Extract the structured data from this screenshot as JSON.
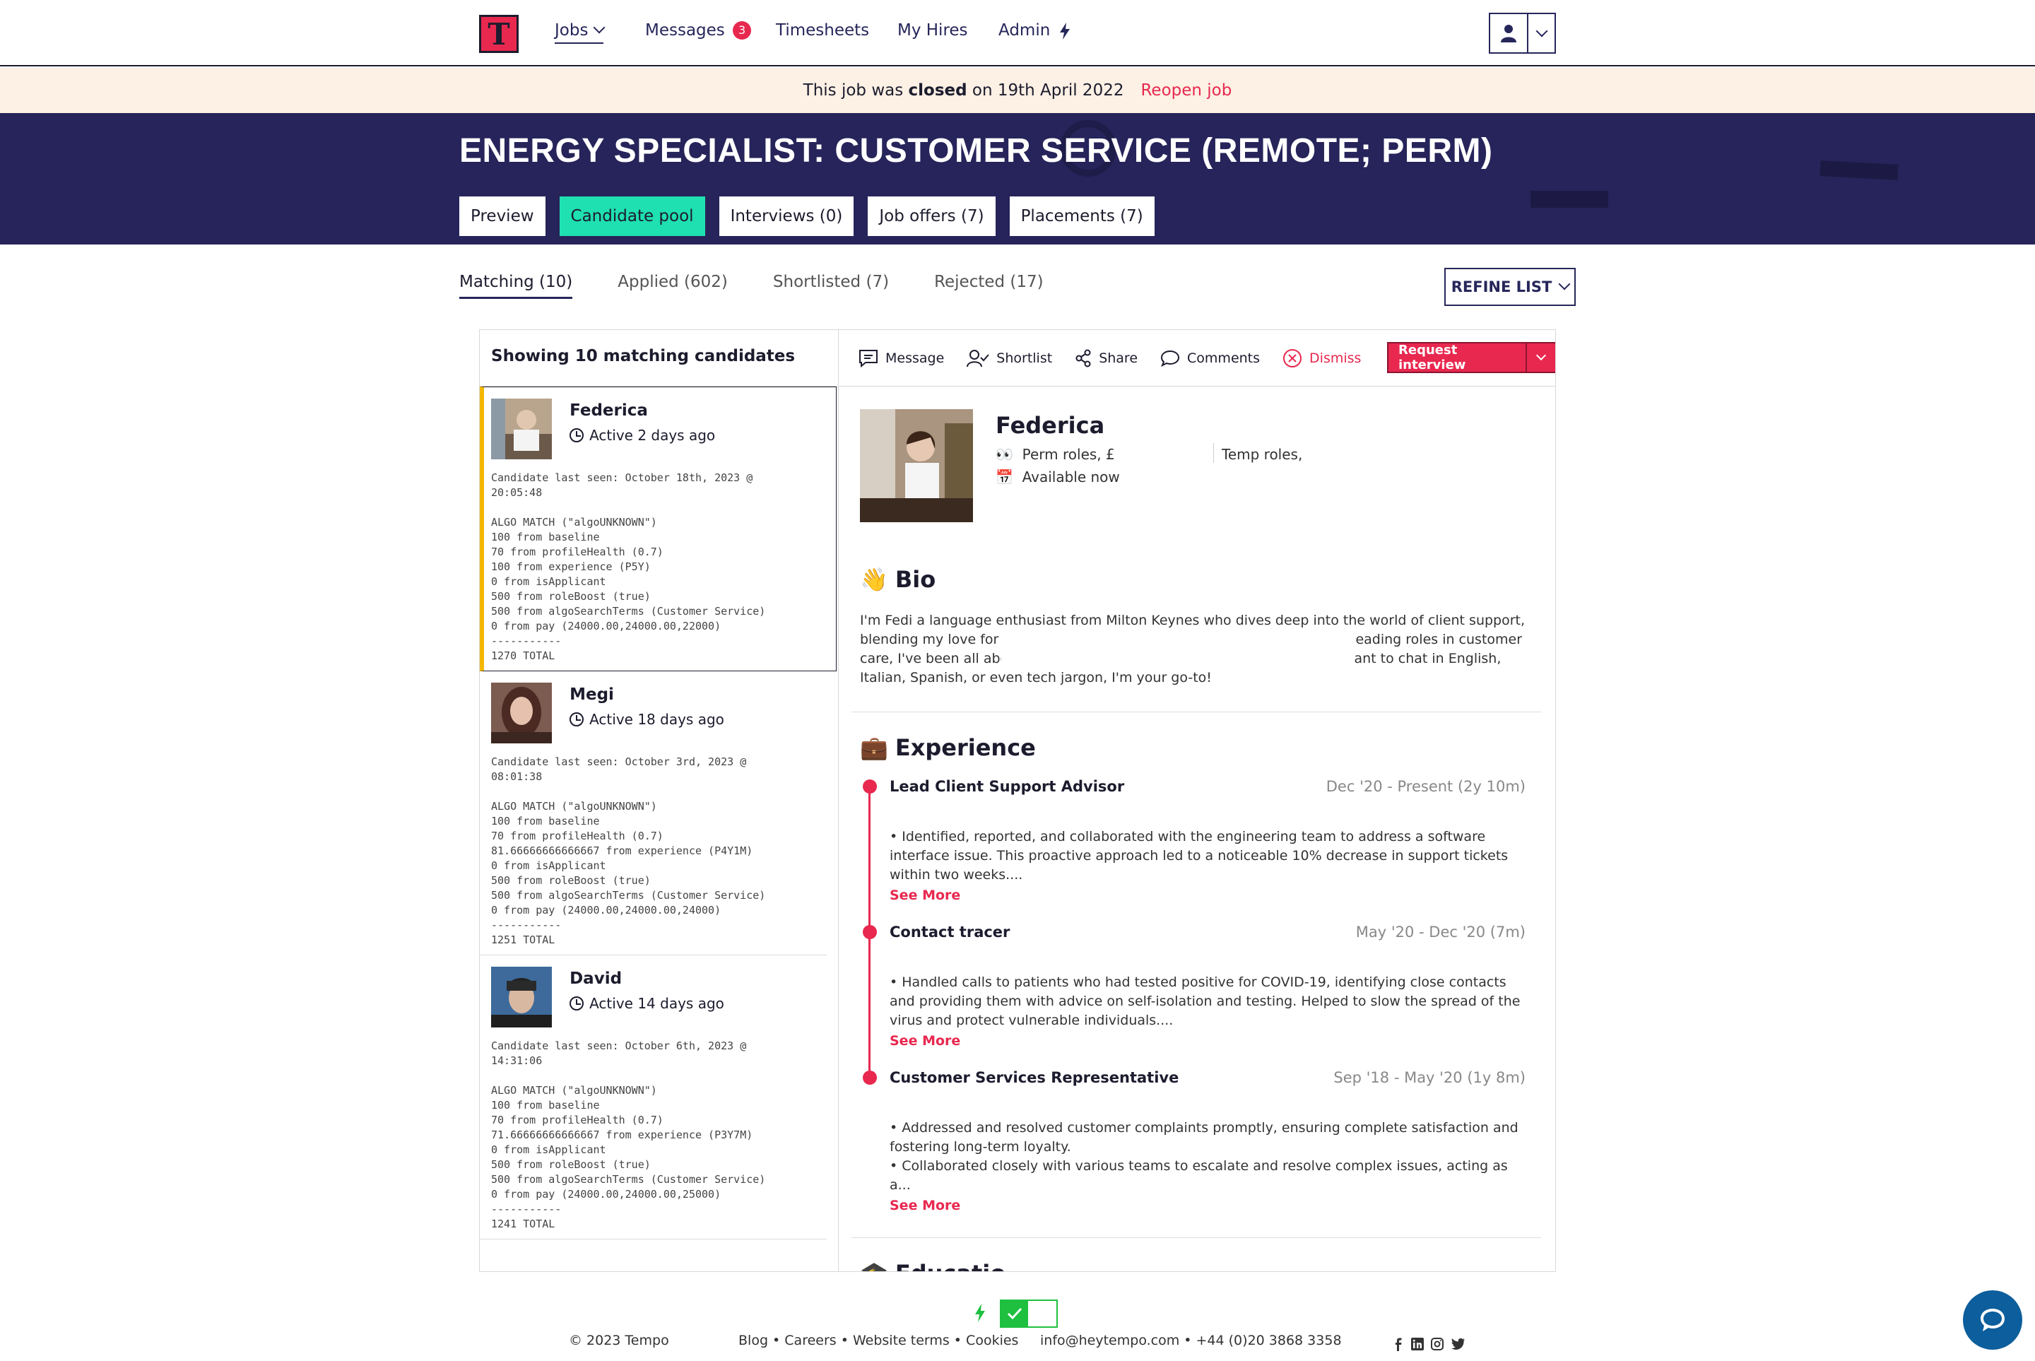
{
  "nav": {
    "logo_letter": "T",
    "items": [
      {
        "label": "Jobs"
      },
      {
        "label": "Messages",
        "badge": "3"
      },
      {
        "label": "Timesheets"
      },
      {
        "label": "My Hires"
      },
      {
        "label": "Admin"
      }
    ]
  },
  "banner": {
    "prefix": "This job was",
    "closed_word": "closed",
    "suffix": "on 19th April 2022",
    "reopen_label": "Reopen job"
  },
  "job": {
    "title": "ENERGY SPECIALIST: CUSTOMER SERVICE (REMOTE; PERM)",
    "tabs": [
      {
        "label": "Preview"
      },
      {
        "label": "Candidate pool"
      },
      {
        "label": "Interviews (0)"
      },
      {
        "label": "Job offers (7)"
      },
      {
        "label": "Placements (7)"
      }
    ]
  },
  "subtabs": [
    {
      "label": "Matching (10)"
    },
    {
      "label": "Applied (602)"
    },
    {
      "label": "Shortlisted (7)"
    },
    {
      "label": "Rejected (17)"
    }
  ],
  "refine_label": "REFINE LIST",
  "list": {
    "heading": "Showing 10 matching candidates",
    "candidates": [
      {
        "name": "Federica",
        "active": "Active 2 days ago",
        "last_seen_1": "Candidate last seen: October 18th, 2023 @",
        "last_seen_2": "20:05:48",
        "algo": [
          "ALGO MATCH (\"algoUNKNOWN\")",
          "100 from baseline",
          "70 from profileHealth (0.7)",
          "100 from experience (P5Y)",
          "0 from isApplicant",
          "500 from roleBoost (true)",
          "500 from algoSearchTerms (Customer Service)",
          "0 from pay (24000.00,24000.00,22000)",
          "-----------",
          "1270 TOTAL"
        ]
      },
      {
        "name": "Megi",
        "active": "Active 18 days ago",
        "last_seen_1": "Candidate last seen: October 3rd, 2023 @",
        "last_seen_2": "08:01:38",
        "algo": [
          "ALGO MATCH (\"algoUNKNOWN\")",
          "100 from baseline",
          "70 from profileHealth (0.7)",
          "81.66666666666667 from experience (P4Y1M)",
          "0 from isApplicant",
          "500 from roleBoost (true)",
          "500 from algoSearchTerms (Customer Service)",
          "0 from pay (24000.00,24000.00,24000)",
          "-----------",
          "1251 TOTAL"
        ]
      },
      {
        "name": "David",
        "active": "Active 14 days ago",
        "last_seen_1": "Candidate last seen: October 6th, 2023 @",
        "last_seen_2": "14:31:06",
        "algo": [
          "ALGO MATCH (\"algoUNKNOWN\")",
          "100 from baseline",
          "70 from profileHealth (0.7)",
          "71.66666666666667 from experience (P3Y7M)",
          "0 from isApplicant",
          "500 from roleBoost (true)",
          "500 from algoSearchTerms (Customer Service)",
          "0 from pay (24000.00,24000.00,25000)",
          "-----------",
          "1241 TOTAL"
        ]
      }
    ]
  },
  "toolbar": {
    "message": "Message",
    "shortlist": "Shortlist",
    "share": "Share",
    "comments": "Comments",
    "dismiss": "Dismiss",
    "request": "Request interview"
  },
  "profile": {
    "name": "Federica",
    "perm": "Perm roles, £",
    "temp": "Temp roles,",
    "availability": "Available now",
    "bio_title": "Bio",
    "bio_text": "I'm Fedi a language enthusiast from Milton Keynes who dives deep into the world of client support, blending my love for languages and people. From my stint at the NHS to leading roles in customer care, I've been all about creating smooth experiences—so whether you want to chat in English, Italian, Spanish, or even tech jargon, I'm your go-to!",
    "exp_title": "Experience",
    "experience": [
      {
        "title": "Lead Client Support Advisor",
        "dates": "Dec '20 - Present (2y 10m)",
        "body": "• Identified, reported, and collaborated with the engineering team to address a software interface issue. This proactive approach led to a noticeable 10% decrease in support tickets within two weeks....",
        "see_more": "See More"
      },
      {
        "title": "Contact tracer",
        "dates": "May '20 - Dec '20 (7m)",
        "body": "• Handled calls to patients who had tested positive for COVID-19, identifying close contacts and providing them with advice on self-isolation and testing. Helped to slow the spread of the virus and protect vulnerable individuals....",
        "see_more": "See More"
      },
      {
        "title": "Customer Services Representative",
        "dates": "Sep '18 - May '20 (1y 8m)",
        "body": "• Addressed and resolved customer complaints promptly, ensuring complete satisfaction and fostering long-term loyalty.\n• Collaborated closely with various teams to escalate and resolve complex issues, acting as a...",
        "see_more": "See More"
      }
    ],
    "edu_title": "Educatio"
  },
  "footer": {
    "copyright": "© 2023 Tempo",
    "links": "Blog • Careers • Website terms • Cookies",
    "contact": "info@heytempo.com • +44 (0)20 3868 3358"
  },
  "colors": {
    "brand_pink": "#e8284f",
    "navy": "#26245a",
    "mint": "#1fe0b0",
    "highlight": "#f5b800"
  }
}
